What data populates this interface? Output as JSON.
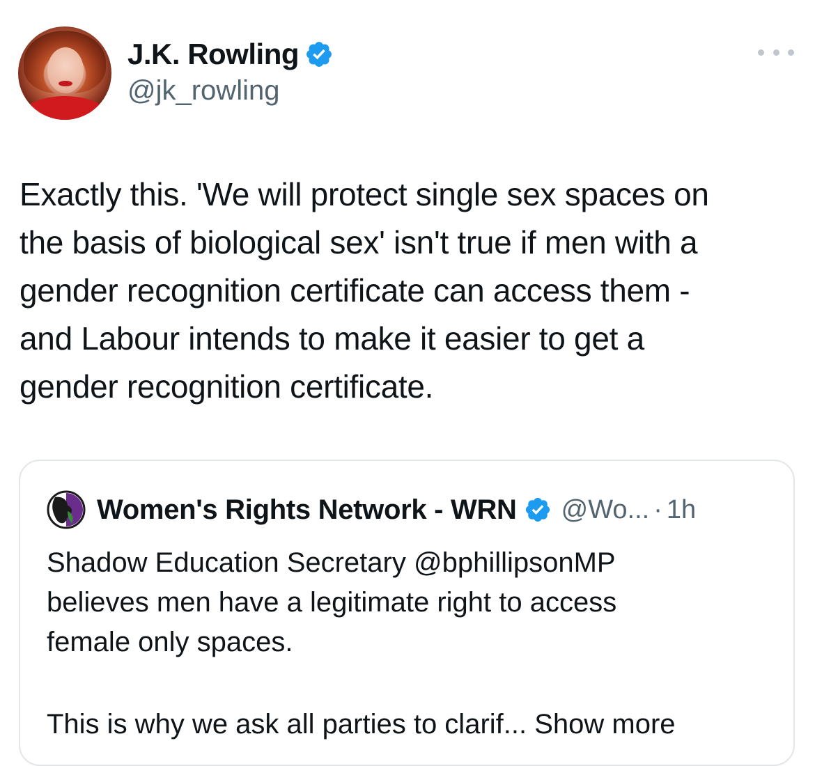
{
  "author": {
    "display_name": "J.K. Rowling",
    "handle": "@jk_rowling",
    "verified": true,
    "avatar_icon": "profile-photo"
  },
  "tweet": {
    "text": "Exactly this. 'We will protect single sex spaces on\nthe basis of biological sex' isn't true if men with a\ngender recognition certificate can access them -\nand Labour intends to make it easier to get a\ngender recognition certificate."
  },
  "more_menu": {
    "icon": "more-horizontal-icon"
  },
  "quoted_tweet": {
    "display_name": "Women's Rights Network - WRN",
    "handle": "@Wo...",
    "separator": "·",
    "time": "1h",
    "verified": true,
    "text": "Shadow Education Secretary @bphillipsonMP\nbelieves men have a legitimate right to access\nfemale only spaces.",
    "last_line": "This is why we ask all parties to clarif...",
    "show_more": "Show more"
  },
  "colors": {
    "text": "#0f1419",
    "secondary": "#536471",
    "verified_blue": "#1d9bf0",
    "border": "#e2e6ea"
  }
}
